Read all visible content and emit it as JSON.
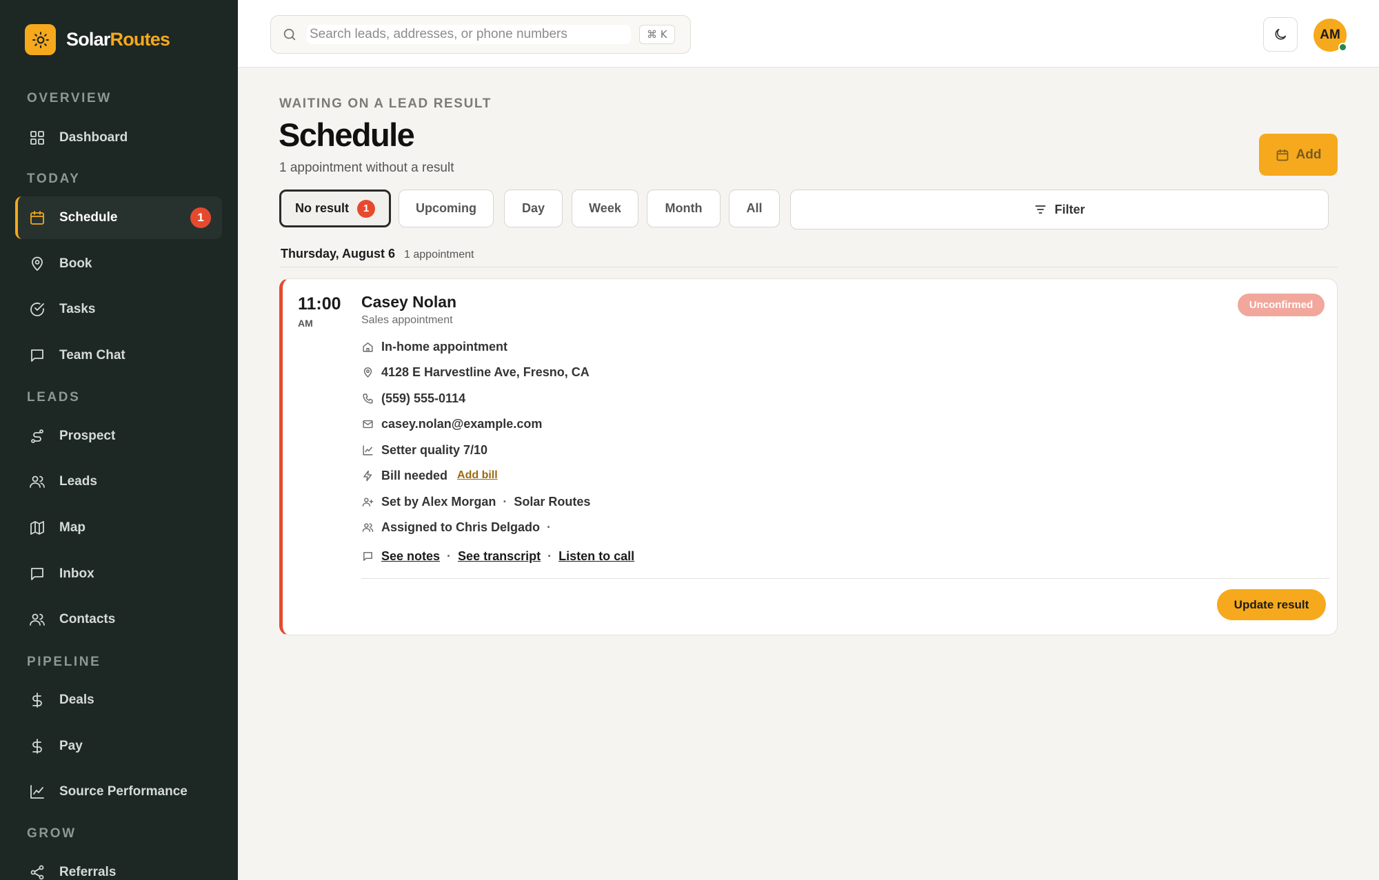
{
  "brand": {
    "name_primary": "Solar",
    "name_accent": "Routes",
    "logo_icon": "sun-icon",
    "accent_color": "#f6a91c"
  },
  "sidebar": {
    "sections": [
      {
        "label": "OVERVIEW"
      },
      {
        "label": "TODAY"
      },
      {
        "label": "LEADS"
      },
      {
        "label": "PIPELINE"
      },
      {
        "label": "GROW"
      }
    ],
    "items": [
      {
        "label": "Dashboard",
        "icon": "grid-icon"
      },
      {
        "label": "Schedule",
        "icon": "calendar-icon",
        "active": true,
        "badge": "1"
      },
      {
        "label": "Book",
        "icon": "map-pin-icon"
      },
      {
        "label": "Tasks",
        "icon": "check-circle-icon"
      },
      {
        "label": "Team Chat",
        "icon": "chat-icon"
      },
      {
        "label": "Prospect",
        "icon": "route-icon"
      },
      {
        "label": "Leads",
        "icon": "users-icon"
      },
      {
        "label": "Map",
        "icon": "map-icon"
      },
      {
        "label": "Inbox",
        "icon": "inbox-icon"
      },
      {
        "label": "Contacts",
        "icon": "contacts-icon"
      },
      {
        "label": "Deals",
        "icon": "dollar-icon"
      },
      {
        "label": "Pay",
        "icon": "dollar-icon"
      },
      {
        "label": "Source Performance",
        "icon": "line-chart-icon"
      },
      {
        "label": "Referrals",
        "icon": "share-icon"
      }
    ]
  },
  "topbar": {
    "search_placeholder": "Search leads, addresses, or phone numbers",
    "shortcut": "⌘ K",
    "theme_icon": "moon-icon",
    "avatar_initials": "AM"
  },
  "header": {
    "eyebrow": "WAITING ON A LEAD RESULT",
    "title": "Schedule",
    "subtitle": "1 appointment without a result",
    "add_label": "Add"
  },
  "tabs": [
    {
      "label": "No result",
      "active": true,
      "badge": "1"
    },
    {
      "label": "Upcoming"
    },
    {
      "label": "Day"
    },
    {
      "label": "Week"
    },
    {
      "label": "Month"
    },
    {
      "label": "All"
    }
  ],
  "filter_label": "Filter",
  "day_group": {
    "date": "Thursday, August 6",
    "count": "1 appointment"
  },
  "appointment": {
    "time": "11:00",
    "ampm": "AM",
    "name": "Casey Nolan",
    "type": "Sales appointment",
    "status": "Unconfirmed",
    "location_type": "In-home appointment",
    "address": "4128 E Harvestline Ave, Fresno, CA",
    "phone": "(559) 555-0114",
    "email": "casey.nolan@example.com",
    "setter_quality": "Setter quality 7/10",
    "bill_status": "Bill needed",
    "add_bill_label": "Add bill",
    "set_by": "Set by Alex Morgan",
    "set_by_company": "Solar Routes",
    "assigned_to": "Assigned to Chris Delgado",
    "links": {
      "notes": "See notes",
      "transcript": "See transcript",
      "call": "Listen to call"
    },
    "update_label": "Update result",
    "accent_color": "#e64a2e"
  }
}
